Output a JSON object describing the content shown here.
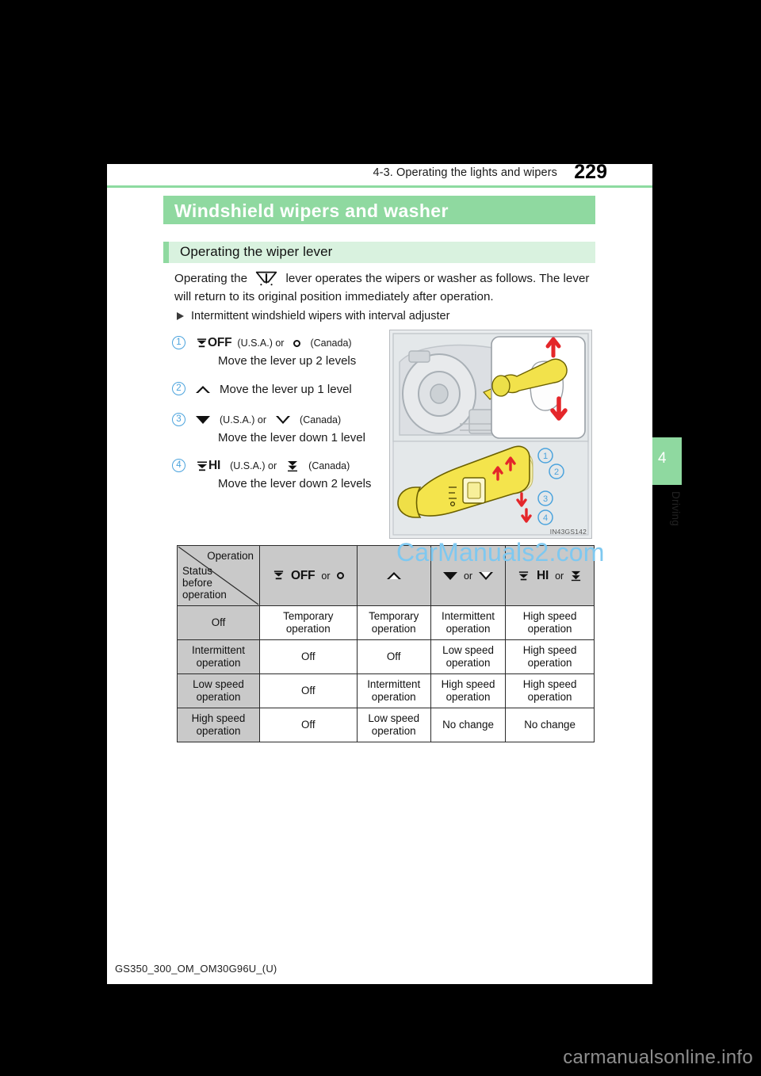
{
  "header": {
    "running_head": "4-3. Operating the lights and wipers",
    "page_number": "229"
  },
  "section": {
    "title": "Windshield wipers and washer",
    "subsection_title": "Operating the wiper lever",
    "intro_before_icon": "Operating the",
    "intro_after_icon": "lever operates the wipers or washer as follows. The lever will return to its original position immediately after operation.",
    "bullet": "Intermittent windshield wipers with interval adjuster"
  },
  "steps": [
    {
      "num": "1",
      "code": "OFF",
      "usa_label": "(U.S.A.) or",
      "canada_label": "(Canada)",
      "action": "Move the lever up 2 levels",
      "usa_icon": "wiper-off-icon",
      "canada_icon": "circle-icon"
    },
    {
      "num": "2",
      "code": "",
      "usa_label": "",
      "canada_label": "",
      "action": "Move the lever up 1 level",
      "inline_action": "Move the lever up 1 level",
      "usa_icon": "up-triangle-hollow-icon",
      "canada_icon": ""
    },
    {
      "num": "3",
      "code": "",
      "usa_label": "(U.S.A.) or",
      "canada_label": "(Canada)",
      "action": "Move the lever down 1 level",
      "usa_icon": "down-triangle-solid-icon",
      "canada_icon": "down-triangle-hollow-icon"
    },
    {
      "num": "4",
      "code": "HI",
      "usa_label": "(U.S.A.) or",
      "canada_label": "(Canada)",
      "action": "Move the lever down 2 levels",
      "usa_icon": "wiper-hi-icon",
      "canada_icon": "double-chevron-down-icon"
    }
  ],
  "figure": {
    "caption": "IN43GS142",
    "callouts": [
      "1",
      "2",
      "3",
      "4"
    ]
  },
  "table": {
    "corner_operation": "Operation",
    "corner_status": "Status\nbefore\noperation",
    "corner_status_lines": [
      "Status",
      "before",
      "operation"
    ],
    "columns": [
      {
        "code": "OFF",
        "or": "or",
        "icon_a": "wiper-off-icon",
        "icon_b": "circle-icon"
      },
      {
        "code": "",
        "or": "",
        "icon_a": "up-triangle-hollow-icon",
        "icon_b": ""
      },
      {
        "code": "",
        "or": "or",
        "icon_a": "down-triangle-solid-icon",
        "icon_b": "down-triangle-hollow-icon"
      },
      {
        "code": "HI",
        "or": "or",
        "icon_a": "wiper-hi-icon",
        "icon_b": "double-chevron-down-icon"
      }
    ],
    "rows": [
      {
        "status": "Off",
        "cells": [
          "Temporary\noperation",
          "Temporary\noperation",
          "Intermittent\noperation",
          "High speed\noperation"
        ]
      },
      {
        "status": "Intermittent\noperation",
        "cells": [
          "Off",
          "Off",
          "Low speed\noperation",
          "High speed\noperation"
        ]
      },
      {
        "status": "Low speed\noperation",
        "cells": [
          "Off",
          "Intermittent\noperation",
          "High speed\noperation",
          "High speed\noperation"
        ]
      },
      {
        "status": "High speed\noperation",
        "cells": [
          "Off",
          "Low speed\noperation",
          "No change",
          "No change"
        ]
      }
    ]
  },
  "watermarks": {
    "table_overlay": "CarManuals2.com",
    "bottom_banner": "carmanualsonline.info"
  },
  "footer": {
    "document_code": "GS350_300_OM_OM30G96U_(U)"
  },
  "sidetab": {
    "number": "4",
    "label": "Driving"
  },
  "colors": {
    "accent_green": "#8fd9a0",
    "light_green": "#d9f2df",
    "callout_blue": "#4ba3dd",
    "table_header_gray": "#c9c9c9",
    "watermark_blue": "#7ec8f0"
  }
}
